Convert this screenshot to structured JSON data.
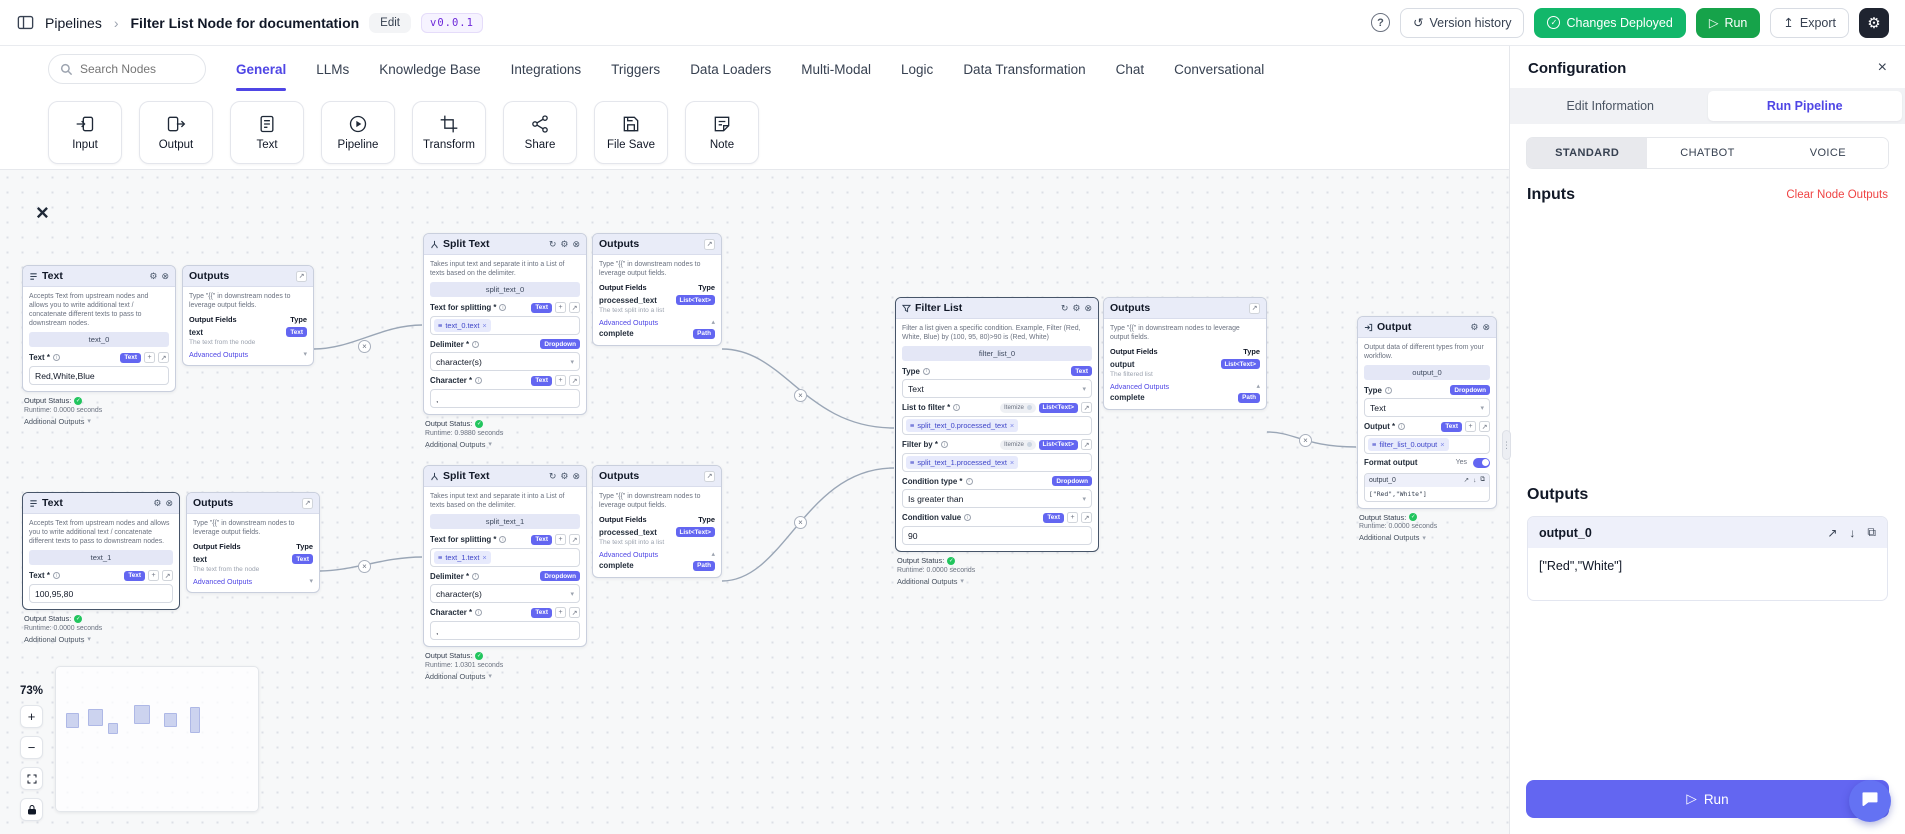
{
  "icons": {
    "gear": "⚙",
    "close": "⊗",
    "x": "×",
    "expand": "↗",
    "download": "↓",
    "copy": "⧉",
    "chevron_down": "▾",
    "chevron_up": "▴",
    "check": "✓",
    "play": "▷",
    "export": "↥",
    "history": "↺",
    "help": "?",
    "drag": "≡",
    "plus": "+",
    "minus": "−",
    "info": "i",
    "breadcrumb_chevron": "›",
    "dots": "⋮"
  },
  "topbar": {
    "breadcrumb": "Pipelines",
    "title": "Filter List Node for documentation",
    "edit": "Edit",
    "version": "v0.0.1",
    "version_history": "Version history",
    "deployed": "Changes Deployed",
    "run": "Run",
    "export": "Export"
  },
  "palette": {
    "search_placeholder": "Search Nodes",
    "tabs": [
      "General",
      "LLMs",
      "Knowledge Base",
      "Integrations",
      "Triggers",
      "Data Loaders",
      "Multi-Modal",
      "Logic",
      "Data Transformation",
      "Chat",
      "Conversational"
    ],
    "cards": [
      "Input",
      "Output",
      "Text",
      "Pipeline",
      "Transform",
      "Share",
      "File Save",
      "Note"
    ]
  },
  "canvas": {
    "zoom": "73%",
    "shared": {
      "outputs_title": "Outputs",
      "hint": "Type \"{{\" in downstream nodes to leverage output fields.",
      "fields_col": "Output Fields",
      "type_col": "Type",
      "advanced": "Advanced Outputs",
      "additional": "Additional Outputs",
      "status_label": "Output Status:",
      "complete": "complete",
      "path_badge": "Path",
      "text_badge": "Text",
      "dropdown_badge": "Dropdown",
      "list_text_badge": "List<Text>",
      "itemize": "Itemize"
    },
    "text0": {
      "title": "Text",
      "desc": "Accepts Text from upstream nodes and allows you to write additional text / concatenate different texts to pass to downstream nodes.",
      "name": "text_0",
      "field": "Text *",
      "value": "Red,White,Blue",
      "runtime": "Runtime: 0.0000 seconds"
    },
    "text0_out": {
      "row": "text",
      "row_desc": "The text from the node"
    },
    "text1": {
      "name": "text_1",
      "value": "100,95,80",
      "runtime": "Runtime: 0.0000 seconds"
    },
    "split0": {
      "title": "Split Text",
      "desc": "Takes input text and separate it into a List of texts based on the delimiter.",
      "name": "split_text_0",
      "field1": "Text for splitting *",
      "chip": "text_0.text",
      "field2": "Delimiter *",
      "delimiter_value": "character(s)",
      "field3": "Character *",
      "char_value": ",",
      "runtime": "Runtime: 0.9880 seconds"
    },
    "split_out": {
      "row": "processed_text",
      "row_desc": "The text split into a list"
    },
    "split1": {
      "name": "split_text_1",
      "chip": "text_1.text",
      "runtime": "Runtime: 1.0301 seconds"
    },
    "filter": {
      "title": "Filter List",
      "desc": "Filter a list given a specific condition. Example, Filter (Red, White, Blue) by (100, 95, 80)>90 is (Red, White)",
      "name": "filter_list_0",
      "type_label": "Type",
      "type_value": "Text",
      "list_label": "List to filter *",
      "list_chip": "split_text_0.processed_text",
      "filterby_label": "Filter by *",
      "filterby_chip": "split_text_1.processed_text",
      "cond_type_label": "Condition type *",
      "cond_type_value": "Is greater than",
      "cond_value_label": "Condition value",
      "cond_value": "90",
      "runtime": "Runtime: 0.0000 seconds"
    },
    "filter_out": {
      "row": "output",
      "row_desc": "The filtered list"
    },
    "output0": {
      "title": "Output",
      "desc": "Output data of different types from your workflow.",
      "name": "output_0",
      "type_label": "Type",
      "type_value": "Text",
      "out_label": "Output *",
      "chip": "filter_list_0.output",
      "format_label": "Format output",
      "format_value": "Yes",
      "preview_title": "output_0",
      "preview_value": "[\"Red\",\"White\"]",
      "runtime": "Runtime: 0.0000 seconds"
    }
  },
  "panel": {
    "title": "Configuration",
    "tab_edit": "Edit Information",
    "tab_run": "Run Pipeline",
    "subtabs": [
      "STANDARD",
      "CHATBOT",
      "VOICE"
    ],
    "inputs": "Inputs",
    "clear": "Clear Node Outputs",
    "outputs": "Outputs",
    "card_title": "output_0",
    "card_value": "[\"Red\",\"White\"]",
    "run": "Run"
  }
}
